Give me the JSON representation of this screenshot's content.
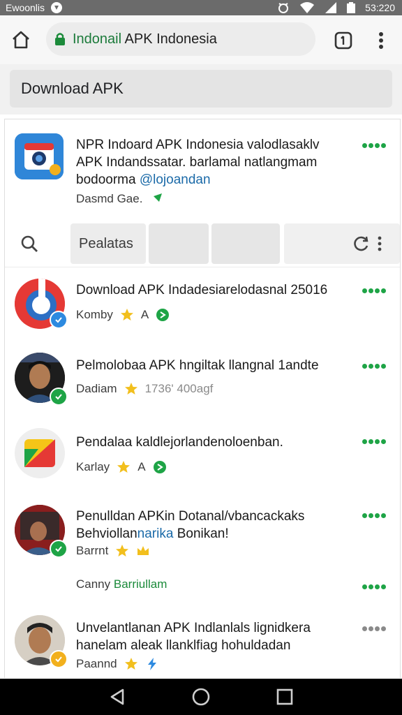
{
  "status_bar": {
    "carrier": "Ewoonlis",
    "time": "53:220"
  },
  "browser": {
    "url_highlight": "Indonail",
    "url_rest": " APK Indonesia",
    "search_value": "Download APK"
  },
  "featured": {
    "line1": "NPR Indoard APK Indonesia valodlasaklv",
    "line2": "APK Indandssatar. barlamal natlangmam",
    "line3_plain": "bodoorma ",
    "line3_link": "@lojoandan",
    "meta": "Dasmd Gae."
  },
  "filter": {
    "chip_label": "Pealatas"
  },
  "items": [
    {
      "title": "Download APK Indadesiarelodasnal 25016",
      "meta": "Komby",
      "rating": "A"
    },
    {
      "title": "Pelmolobaa APK hngiltak llangnal 1andte",
      "meta": "Dadiam",
      "rating": "1736' 400agf"
    },
    {
      "title": "Pendalaa kaldlejorlandenoloenban.",
      "meta": "Karlay",
      "rating": "A"
    },
    {
      "title": "Penulldan APKin Dotanal/vbancackaks",
      "line2_plain": "Behviollan",
      "line2_link": "narika",
      "line2_rest": " Bonikan!",
      "meta": "Barrnt"
    },
    {
      "meta_plain": "Canny ",
      "meta_green": "Barriullam"
    },
    {
      "title": "Unvelantlanan APK Indlanlals lignidkera",
      "line2": "hanelam aleak llanklfiag hohuldadan",
      "meta": "Paannd"
    }
  ],
  "colors": {
    "accent_green": "#1ea446",
    "link_blue": "#1b6aa8",
    "star": "#f2bf1d"
  }
}
